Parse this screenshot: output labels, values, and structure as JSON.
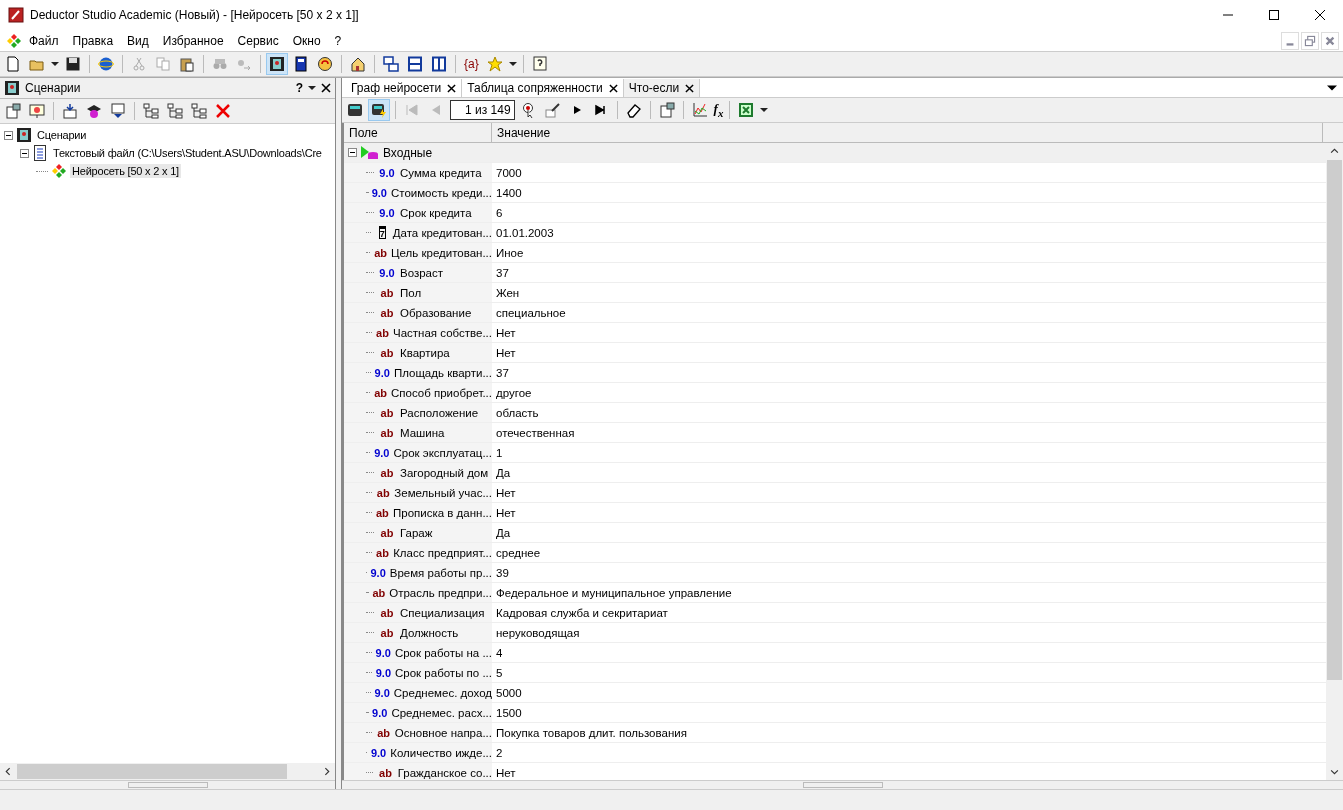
{
  "window": {
    "title": "Deductor Studio Academic (Новый) - [Нейросеть [50 x 2 x 1]]"
  },
  "menu": [
    "Файл",
    "Правка",
    "Вид",
    "Избранное",
    "Сервис",
    "Окно",
    "?"
  ],
  "toolbar": {
    "variables_button": "{a}"
  },
  "left_panel": {
    "title": "Сценарии",
    "help": "?",
    "tree": [
      {
        "label": "Сценарии",
        "kind": "scenarios",
        "expanded": true,
        "selected": false,
        "children": [
          {
            "label": "Текстовый файл (C:\\Users\\Student.ASU\\Downloads\\Cre",
            "kind": "file",
            "expanded": true,
            "selected": false,
            "children": [
              {
                "label": "Нейросеть [50 x 2 x 1]",
                "kind": "net",
                "selected": true
              }
            ]
          }
        ]
      }
    ]
  },
  "tabs": [
    {
      "label": "Граф нейросети",
      "selected": false
    },
    {
      "label": "Таблица сопряженности",
      "selected": false
    },
    {
      "label": "Что-если",
      "selected": true
    }
  ],
  "navigator": {
    "record": "1 из 149",
    "formula_button": "f$_{x}$"
  },
  "table": {
    "columns": [
      "Поле",
      "Значение"
    ],
    "group": {
      "label": "Входные",
      "expanded": true
    },
    "rows": [
      {
        "kind": "number",
        "type": "9.0",
        "name": "Сумма кредита",
        "value": "7000"
      },
      {
        "kind": "number",
        "type": "9.0",
        "name": "Стоимость креди...",
        "value": "1400"
      },
      {
        "kind": "number",
        "type": "9.0",
        "name": "Срок кредита",
        "value": "6"
      },
      {
        "kind": "date",
        "type": "7",
        "name": "Дата кредитован...",
        "value": "01.01.2003"
      },
      {
        "kind": "text",
        "type": "ab",
        "name": "Цель кредитован...",
        "value": "Иное"
      },
      {
        "kind": "number",
        "type": "9.0",
        "name": "Возраст",
        "value": "37"
      },
      {
        "kind": "text",
        "type": "ab",
        "name": "Пол",
        "value": "Жен"
      },
      {
        "kind": "text",
        "type": "ab",
        "name": "Образование",
        "value": "специальное"
      },
      {
        "kind": "text",
        "type": "ab",
        "name": "Частная собстве...",
        "value": "Нет"
      },
      {
        "kind": "text",
        "type": "ab",
        "name": "Квартира",
        "value": "Нет"
      },
      {
        "kind": "number",
        "type": "9.0",
        "name": "Площадь кварти...",
        "value": "37"
      },
      {
        "kind": "text",
        "type": "ab",
        "name": "Способ приобрет...",
        "value": "другое"
      },
      {
        "kind": "text",
        "type": "ab",
        "name": "Расположение",
        "value": "область"
      },
      {
        "kind": "text",
        "type": "ab",
        "name": "Машина",
        "value": "отечественная"
      },
      {
        "kind": "number",
        "type": "9.0",
        "name": "Срок эксплуатац...",
        "value": "1"
      },
      {
        "kind": "text",
        "type": "ab",
        "name": "Загородный дом",
        "value": "Да"
      },
      {
        "kind": "text",
        "type": "ab",
        "name": "Земельный учас...",
        "value": "Нет"
      },
      {
        "kind": "text",
        "type": "ab",
        "name": "Прописка в данн...",
        "value": "Нет"
      },
      {
        "kind": "text",
        "type": "ab",
        "name": "Гараж",
        "value": "Да"
      },
      {
        "kind": "text",
        "type": "ab",
        "name": "Класс предприят...",
        "value": "среднее"
      },
      {
        "kind": "number",
        "type": "9.0",
        "name": "Время работы пр...",
        "value": "39"
      },
      {
        "kind": "text",
        "type": "ab",
        "name": "Отрасль предпри...",
        "value": "Федеральное и муниципальное управление"
      },
      {
        "kind": "text",
        "type": "ab",
        "name": "Специализация",
        "value": "Кадровая служба и секритариат"
      },
      {
        "kind": "text",
        "type": "ab",
        "name": "Должность",
        "value": "неруководящая"
      },
      {
        "kind": "number",
        "type": "9.0",
        "name": "Срок работы на ...",
        "value": "4"
      },
      {
        "kind": "number",
        "type": "9.0",
        "name": "Срок работы по ...",
        "value": "5"
      },
      {
        "kind": "number",
        "type": "9.0",
        "name": "Среднемес. доход",
        "value": "5000"
      },
      {
        "kind": "number",
        "type": "9.0",
        "name": "Среднемес. расх...",
        "value": "1500"
      },
      {
        "kind": "text",
        "type": "ab",
        "name": "Основное напра...",
        "value": "Покупка товаров длит. пользования"
      },
      {
        "kind": "number",
        "type": "9.0",
        "name": "Количество ижде...",
        "value": "2"
      },
      {
        "kind": "text",
        "type": "ab",
        "name": "Гражданское со...",
        "value": "Нет"
      }
    ]
  }
}
